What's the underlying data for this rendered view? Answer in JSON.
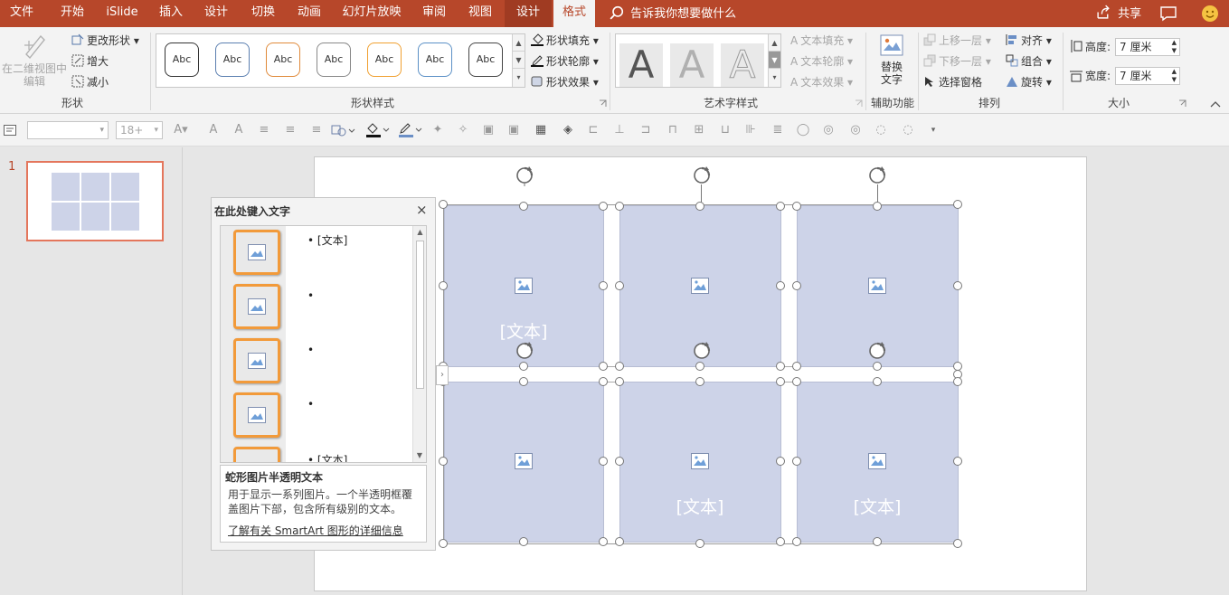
{
  "tabs": {
    "file": "文件",
    "home": "开始",
    "islide": "iSlide",
    "insert": "插入",
    "design": "设计",
    "transitions": "切换",
    "animations": "动画",
    "slideshow": "幻灯片放映",
    "review": "审阅",
    "view": "视图",
    "smartart_design": "设计",
    "format": "格式",
    "tell_me": "告诉我你想要做什么",
    "share": "共享"
  },
  "ribbon": {
    "shapes": {
      "edit_2d": "在二维视图中编辑",
      "change_shape": "更改形状",
      "larger": "增大",
      "smaller": "减小",
      "label": "形状"
    },
    "shape_styles": {
      "swatch_text": "Abc",
      "swatch_colors": [
        "#333333",
        "#5b7fb0",
        "#e08a3a",
        "#888888",
        "#f0a030",
        "#5b90c6",
        "#444444"
      ],
      "fill": "形状填充",
      "outline": "形状轮廓",
      "effects": "形状效果",
      "label": "形状样式"
    },
    "wordart": {
      "letter": "A",
      "text_fill": "文本填充",
      "text_outline": "文本轮廓",
      "text_effects": "文本效果",
      "label": "艺术字样式"
    },
    "accessibility": {
      "alt_text_1": "替换",
      "alt_text_2": "文字",
      "label": "辅助功能"
    },
    "arrange": {
      "bring_forward": "上移一层",
      "send_backward": "下移一层",
      "selection_pane": "选择窗格",
      "align": "对齐",
      "group": "组合",
      "rotate": "旋转",
      "label": "排列"
    },
    "size": {
      "height_label": "高度:",
      "height_value": "7 厘米",
      "width_label": "宽度:",
      "width_value": "7 厘米",
      "label": "大小"
    }
  },
  "qat": {
    "font_size": "18+"
  },
  "thumbs": {
    "slide_number": "1"
  },
  "slide": {
    "cell_texts": [
      "[文本]",
      "[文本]",
      "[文本]"
    ]
  },
  "text_pane": {
    "title": "在此处键入文字",
    "close": "×",
    "bullet_top": "[文本]",
    "bullet_bottom": "[文本]",
    "bullet_dot": "•",
    "desc_title": "蛇形图片半透明文本",
    "desc_body_1": "用于显示一系列图片。一个半透明框覆",
    "desc_body_2": "盖图片下部，包含所有级别的文本。",
    "desc_link": "了解有关 SmartArt 图形的详细信息"
  },
  "colors": {
    "accent": "#b7472a",
    "cell_fill": "#cdd3e8",
    "pic_border": "#f29a3a"
  }
}
